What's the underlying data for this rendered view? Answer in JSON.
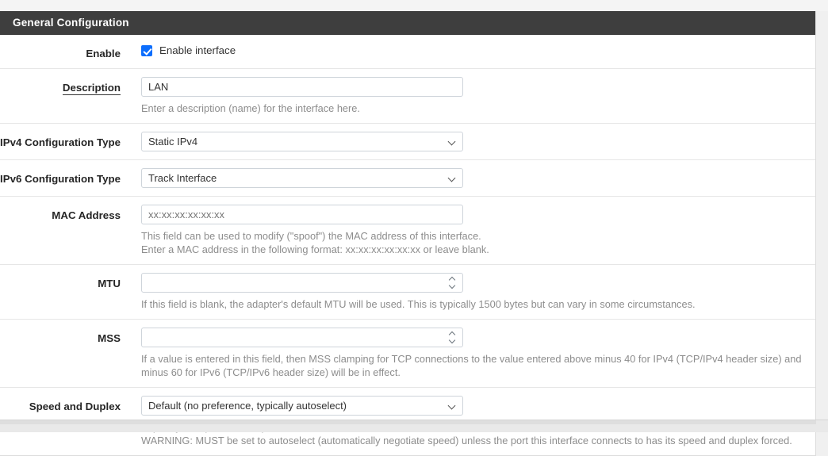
{
  "panel": {
    "heading": "General Configuration"
  },
  "rows": {
    "enable": {
      "label": "Enable",
      "checkbox_label": "Enable interface",
      "checked": true
    },
    "description": {
      "label": "Description",
      "value": "LAN",
      "help": "Enter a description (name) for the interface here."
    },
    "ipv4_config_type": {
      "label": "IPv4 Configuration Type",
      "value": "Static IPv4"
    },
    "ipv6_config_type": {
      "label": "IPv6 Configuration Type",
      "value": "Track Interface"
    },
    "mac_address": {
      "label": "MAC Address",
      "value": "",
      "placeholder": "xx:xx:xx:xx:xx:xx",
      "help_line1": "This field can be used to modify (\"spoof\") the MAC address of this interface.",
      "help_line2": "Enter a MAC address in the following format: xx:xx:xx:xx:xx:xx or leave blank."
    },
    "mtu": {
      "label": "MTU",
      "value": "",
      "help": "If this field is blank, the adapter's default MTU will be used. This is typically 1500 bytes but can vary in some circumstances."
    },
    "mss": {
      "label": "MSS",
      "value": "",
      "help_line1": "If a value is entered in this field, then MSS clamping for TCP connections to the value entered above minus 40 for IPv4 (TCP/IPv4 header size) and",
      "help_line2": "minus 60 for IPv6 (TCP/IPv6 header size) will be in effect."
    },
    "speed_duplex": {
      "label": "Speed and Duplex",
      "value": "Default (no preference, typically autoselect)",
      "help_line1": "Explicitly set speed and duplex mode for this interface.",
      "help_line2": "WARNING: MUST be set to autoselect (automatically negotiate speed) unless the port this interface connects to has its speed and duplex forced."
    }
  },
  "colors": {
    "header_bg": "#3e3e3e",
    "accent": "#0d6efd",
    "help_text": "#8d8d8d",
    "border": "#e6e6e6"
  }
}
